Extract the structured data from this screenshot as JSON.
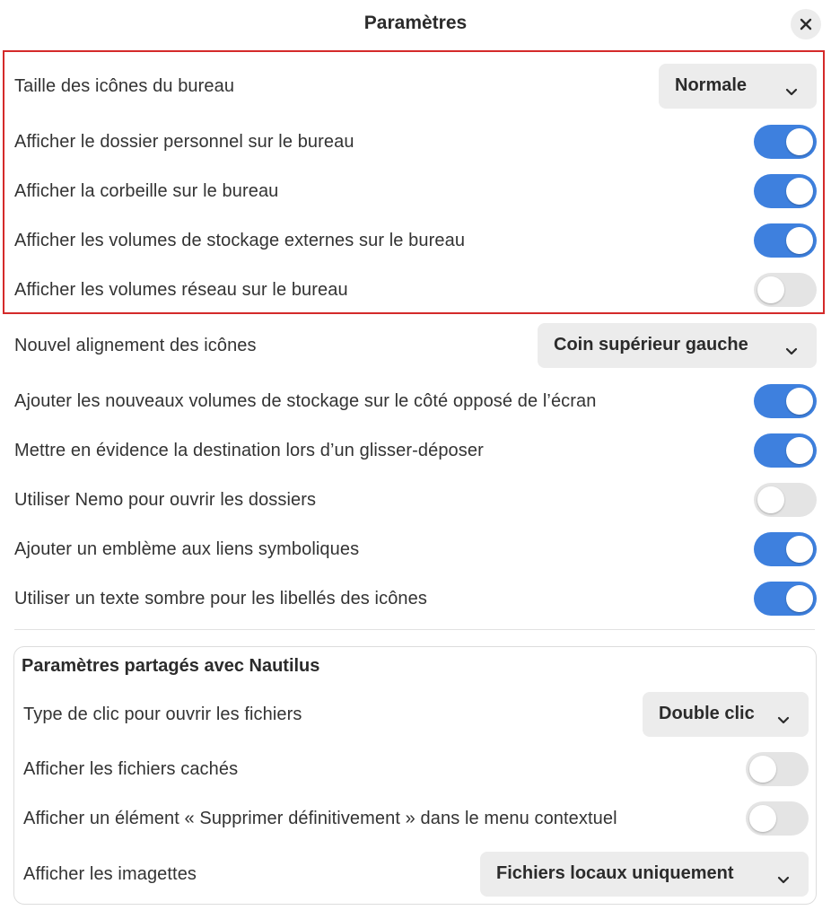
{
  "window": {
    "title": "Paramètres",
    "close_icon": "close-icon"
  },
  "desktop_settings": {
    "icon_size": {
      "label": "Taille des icônes du bureau",
      "value": "Normale"
    },
    "show_home": {
      "label": "Afficher le dossier personnel sur le bureau",
      "enabled": true
    },
    "show_trash": {
      "label": "Afficher la corbeille sur le bureau",
      "enabled": true
    },
    "show_external_volumes": {
      "label": "Afficher les volumes de stockage externes sur le bureau",
      "enabled": true
    },
    "show_network_volumes": {
      "label": "Afficher les volumes réseau sur le bureau",
      "enabled": false
    },
    "new_icon_alignment": {
      "label": "Nouvel alignement des icônes",
      "value": "Coin supérieur gauche"
    },
    "add_volumes_opposite": {
      "label": "Ajouter les nouveaux volumes de stockage sur le côté opposé de l’écran",
      "enabled": true
    },
    "highlight_drop": {
      "label": "Mettre en évidence la destination lors d’un glisser-déposer",
      "enabled": true
    },
    "use_nemo": {
      "label": "Utiliser Nemo pour ouvrir les dossiers",
      "enabled": false
    },
    "symlink_emblem": {
      "label": "Ajouter un emblème aux liens symboliques",
      "enabled": true
    },
    "dark_text": {
      "label": "Utiliser un texte sombre pour les libellés des icônes",
      "enabled": true
    }
  },
  "nautilus_group": {
    "title": "Paramètres partagés avec Nautilus",
    "click_type": {
      "label": "Type de clic pour ouvrir les fichiers",
      "value": "Double clic"
    },
    "show_hidden": {
      "label": "Afficher les fichiers cachés",
      "enabled": false
    },
    "show_delete_permanently": {
      "label": "Afficher un élément « Supprimer définitivement » dans le menu contextuel",
      "enabled": false
    },
    "thumbnails": {
      "label": "Afficher les imagettes",
      "value": "Fichiers locaux uniquement"
    }
  },
  "colors": {
    "accent": "#3e80de",
    "switch_off": "#e4e4e4",
    "highlight_border": "#d42a2a"
  }
}
